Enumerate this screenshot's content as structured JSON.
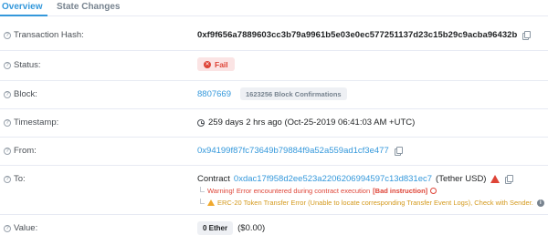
{
  "tabs": [
    {
      "label": "Overview",
      "active": true
    },
    {
      "label": "State Changes",
      "active": false
    }
  ],
  "fields": {
    "tx_hash": {
      "label": "Transaction Hash:",
      "value": "0xf9f656a7889603cc3b79a9961b5e03e0ec577251137d23c15b29c9acba96432b"
    },
    "status": {
      "label": "Status:",
      "value": "Fail",
      "color": "#de4437"
    },
    "block": {
      "label": "Block:",
      "number": "8807669",
      "confirmations": "1623256 Block Confirmations"
    },
    "timestamp": {
      "label": "Timestamp:",
      "value": "259 days 2 hrs ago (Oct-25-2019 06:41:03 AM +UTC)"
    },
    "from": {
      "label": "From:",
      "address": "0x94199f87fc73649b79884f9a52a559ad1cf3e477"
    },
    "to": {
      "label": "To:",
      "prefix": "Contract",
      "address": "0xdac17f958d2ee523a2206206994597c13d831ec7",
      "token_name": "(Tether USD)",
      "error_text": "Warning! Error encountered during contract execution",
      "error_detail": "[Bad instruction]",
      "warning_text": "ERC-20 Token Transfer Error (Unable to locate corresponding Transfer Event Logs), Check with Sender."
    },
    "value": {
      "label": "Value:",
      "amount": "0 Ether",
      "usd": "($0.00)"
    }
  },
  "help_icon_glyph": "?",
  "colors": {
    "link": "#3498db",
    "error": "#de4437",
    "warning": "#d49a1e",
    "badge_bg": "#eef0f4"
  }
}
